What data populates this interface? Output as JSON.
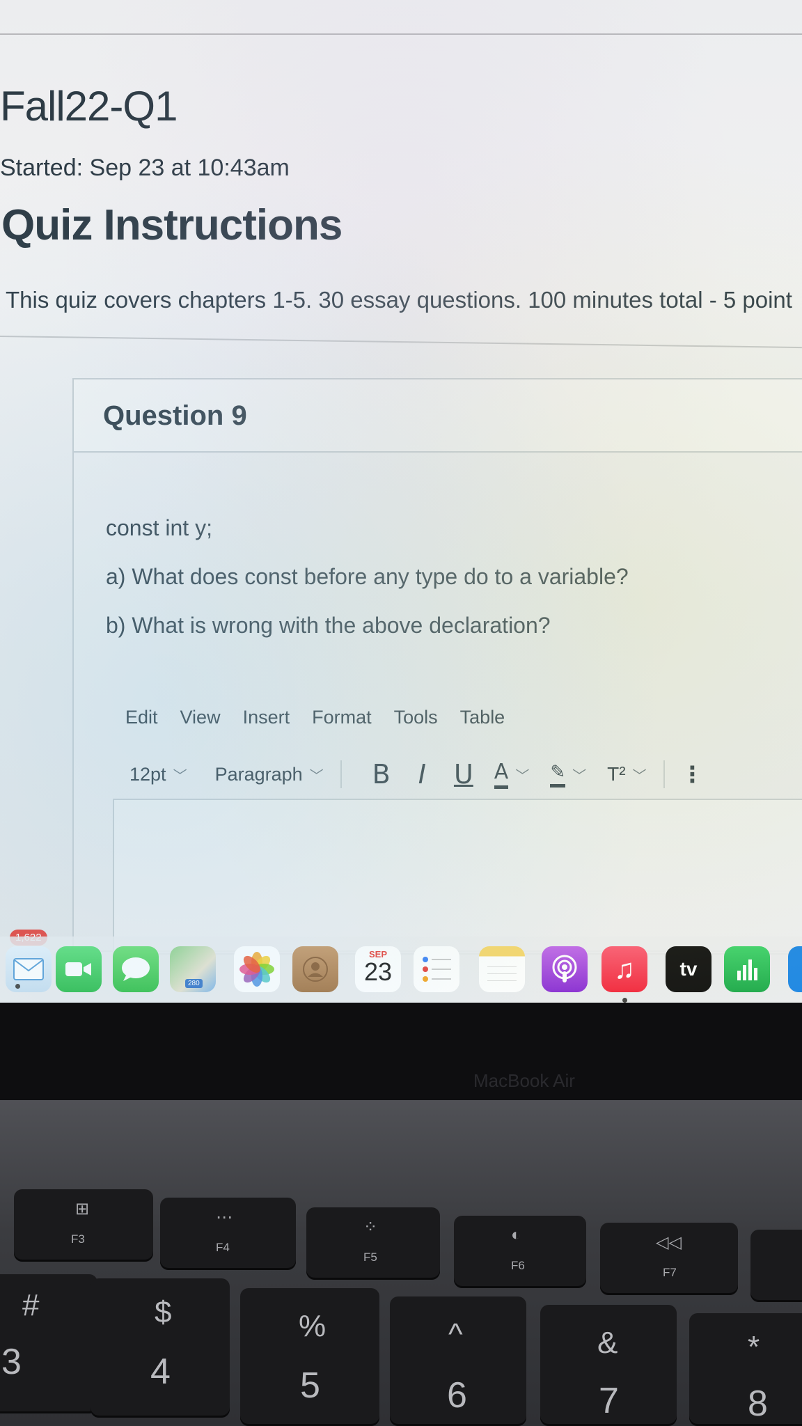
{
  "quiz": {
    "title": "Fall22-Q1",
    "started": "Started: Sep 23 at 10:43am",
    "instructions_heading": "Quiz Instructions",
    "instructions_text": "This quiz covers chapters 1-5. 30 essay questions.  100 minutes total - 5 point"
  },
  "question": {
    "title": "Question 9",
    "lines": [
      "const int y;",
      "a) What does const before any type do to a variable?",
      "b) What is wrong with the above declaration?"
    ]
  },
  "editor": {
    "menu": [
      "Edit",
      "View",
      "Insert",
      "Format",
      "Tools",
      "Table"
    ],
    "font_size": "12pt",
    "block_format": "Paragraph",
    "bold": "B",
    "italic": "I",
    "underline": "U",
    "text_color": "A",
    "superscript": "T²",
    "more": "⋮"
  },
  "dock": {
    "mail_badge": "1,622",
    "calendar_month": "SEP",
    "calendar_day": "23",
    "maps_label": "280",
    "tv_label": "tv",
    "icons": [
      "mail-icon",
      "facetime-icon",
      "messages-icon",
      "maps-icon",
      "photos-icon",
      "contacts-icon",
      "calendar-icon",
      "reminders-icon",
      "notes-icon",
      "podcasts-icon",
      "music-icon",
      "apple-tv-icon",
      "numbers-icon"
    ]
  },
  "laptop": {
    "brand": "MacBook Air"
  },
  "keyboard": {
    "fkeys": [
      {
        "label": "F3",
        "icon": "⊞"
      },
      {
        "label": "F4",
        "icon": "⋯"
      },
      {
        "label": "F5",
        "icon": "⁘"
      },
      {
        "label": "F6",
        "icon": "◐"
      },
      {
        "label": "F7",
        "icon": "◁◁"
      }
    ],
    "numkeys": [
      {
        "top": "#",
        "bottom": "3"
      },
      {
        "top": "$",
        "bottom": "4"
      },
      {
        "top": "%",
        "bottom": "5"
      },
      {
        "top": "^",
        "bottom": "6"
      },
      {
        "top": "&",
        "bottom": "7"
      },
      {
        "top": "*",
        "bottom": "8"
      }
    ]
  },
  "colors": {
    "text": "#2d3b45",
    "border": "#c7cdd1",
    "badge": "#e8423a"
  }
}
